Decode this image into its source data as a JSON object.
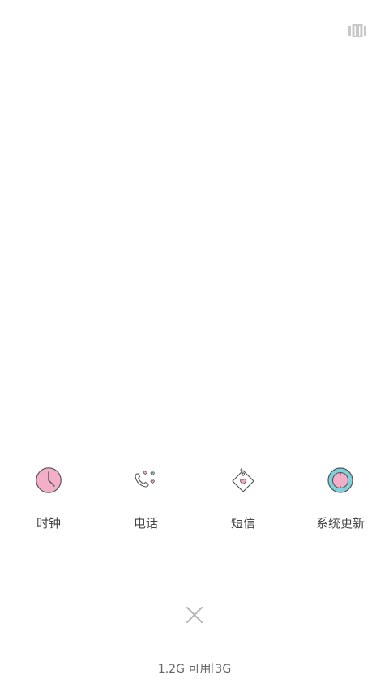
{
  "apps": [
    {
      "name": "clock",
      "label": "时钟"
    },
    {
      "name": "phone",
      "label": "电话"
    },
    {
      "name": "messages",
      "label": "短信"
    },
    {
      "name": "system-update",
      "label": "系统更新"
    }
  ],
  "memory": {
    "available": "1.2G 可用",
    "total": "3G"
  },
  "colors": {
    "pink": "#f3afc8",
    "teal": "#7fd1dc",
    "outline": "#555555"
  }
}
